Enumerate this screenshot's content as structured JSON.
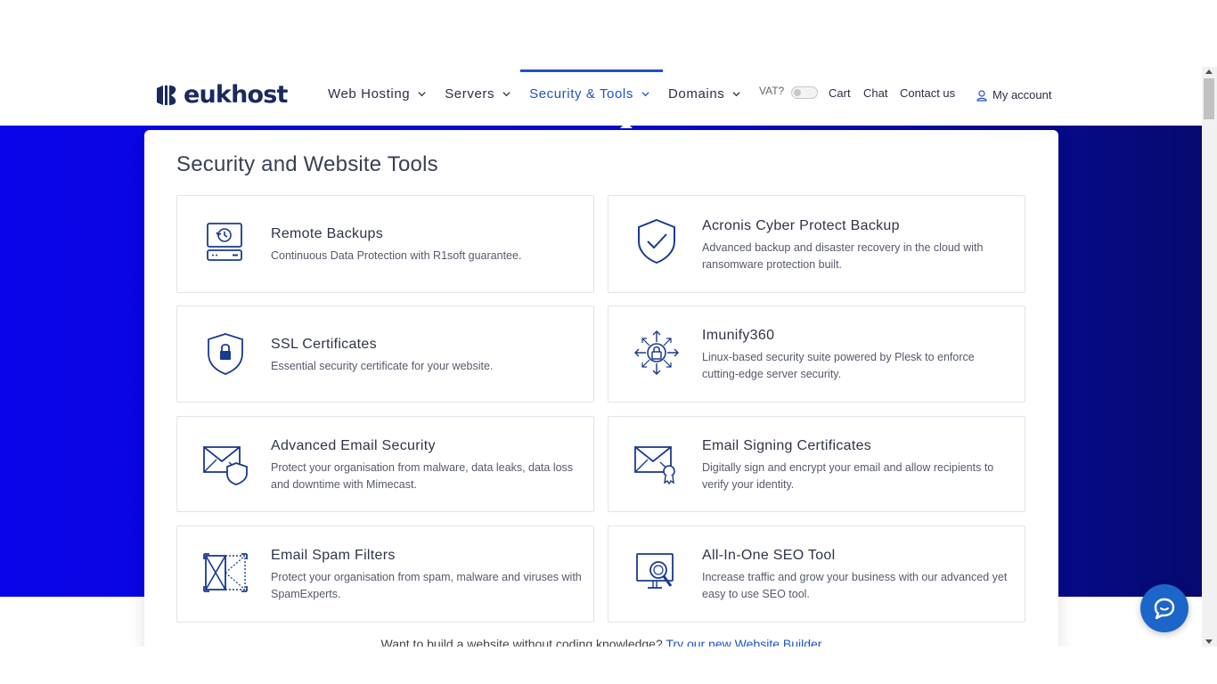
{
  "brand": {
    "name": "eukhost"
  },
  "nav": {
    "items": [
      {
        "label": "Web Hosting",
        "active": false
      },
      {
        "label": "Servers",
        "active": false
      },
      {
        "label": "Security & Tools",
        "active": true
      },
      {
        "label": "Domains",
        "active": false
      }
    ],
    "vat_label": "VAT?",
    "cart": "Cart",
    "chat": "Chat",
    "contact": "Contact us",
    "account": "My account"
  },
  "menu": {
    "title": "Security and Website Tools",
    "cards": [
      {
        "title": "Remote Backups",
        "desc": "Continuous Data Protection with R1soft guarantee.",
        "icon": "backup-drive-icon"
      },
      {
        "title": "Acronis Cyber Protect Backup",
        "desc": "Advanced backup and disaster recovery in the cloud with ransomware protection built.",
        "icon": "shield-check-icon"
      },
      {
        "title": "SSL Certificates",
        "desc": "Essential security certificate for your website.",
        "icon": "shield-lock-icon"
      },
      {
        "title": "Imunify360",
        "desc": "Linux-based security suite powered by Plesk to enforce cutting-edge server security.",
        "icon": "lock-network-icon"
      },
      {
        "title": "Advanced Email Security",
        "desc": "Protect your organisation from malware, data leaks, data loss and downtime with Mimecast.",
        "icon": "envelope-shield-icon"
      },
      {
        "title": "Email Signing Certificates",
        "desc": "Digitally sign and encrypt your email and allow recipients to verify your identity.",
        "icon": "envelope-badge-icon"
      },
      {
        "title": "Email Spam Filters",
        "desc": "Protect your organisation from spam, malware and viruses with SpamExperts.",
        "icon": "spam-filter-icon"
      },
      {
        "title": "All-In-One SEO Tool",
        "desc": "Increase traffic and grow your business with our advanced yet easy to use SEO tool.",
        "icon": "monitor-search-icon"
      }
    ],
    "footer_text": "Want to build a website without coding knowledge? ",
    "footer_link": "Try our new Website Builder"
  },
  "colors": {
    "accent": "#1f52c5",
    "hero_blue": "#0a04ea",
    "hero_dark": "#050a6e",
    "icon": "#1a3a8f"
  }
}
